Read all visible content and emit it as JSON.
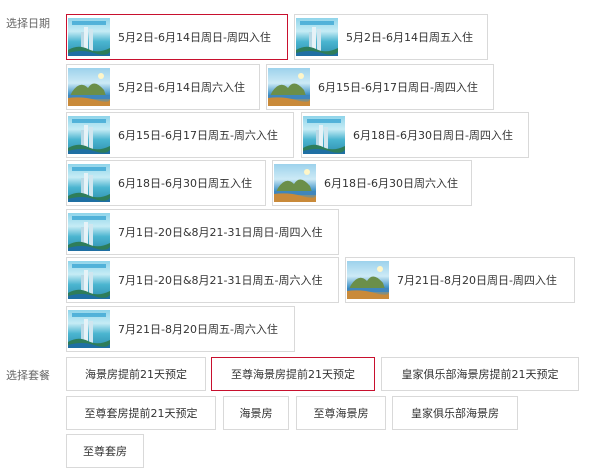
{
  "date_section": {
    "label": "选择日期",
    "options": [
      {
        "text": "5月2日-6月14日周日-周四入住",
        "thumb": "tower"
      },
      {
        "text": "5月2日-6月14日周五入住",
        "thumb": "tower"
      },
      {
        "text": "5月2日-6月14日周六入住",
        "thumb": "island"
      },
      {
        "text": "6月15日-6月17日周日-周四入住",
        "thumb": "island"
      },
      {
        "text": "6月15日-6月17日周五-周六入住",
        "thumb": "tower"
      },
      {
        "text": "6月18日-6月30日周日-周四入住",
        "thumb": "tower"
      },
      {
        "text": "6月18日-6月30日周五入住",
        "thumb": "tower"
      },
      {
        "text": "6月18日-6月30日周六入住",
        "thumb": "island"
      },
      {
        "text": "7月1日-20日&8月21-31日周日-周四入住",
        "thumb": "tower"
      },
      {
        "text": "7月1日-20日&8月21-31日周五-周六入住",
        "thumb": "tower"
      },
      {
        "text": "7月21日-8月20日周日-周四入住",
        "thumb": "island"
      },
      {
        "text": "7月21日-8月20日周五-周六入住",
        "thumb": "tower"
      }
    ],
    "selected_index": 0
  },
  "package_section": {
    "label": "选择套餐",
    "options": [
      "海景房提前21天预定",
      "至尊海景房提前21天预定",
      "皇家俱乐部海景房提前21天预定",
      "至尊套房提前21天预定",
      "海景房",
      "至尊海景房",
      "皇家俱乐部海景房",
      "至尊套房"
    ],
    "selected_index": 1
  },
  "colors": {
    "selected_border": "#c8102e",
    "border": "#d9d9d9",
    "label_text": "#666666",
    "text": "#333333"
  },
  "icons": {
    "tower_thumb": "resort-tower-thumbnail",
    "island_thumb": "resort-island-thumbnail"
  }
}
